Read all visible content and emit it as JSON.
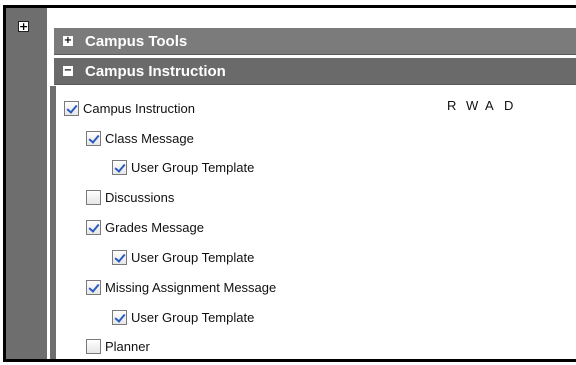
{
  "sections": {
    "tools": {
      "label": "Campus Tools",
      "toggle": "+"
    },
    "instruction": {
      "label": "Campus Instruction",
      "toggle": "−"
    }
  },
  "outer_toggle": "+",
  "rights_headers": [
    "R",
    "W",
    "A",
    "D"
  ],
  "tree": [
    {
      "label": "Campus Instruction",
      "checked": true
    },
    {
      "label": "Class Message",
      "checked": true
    },
    {
      "label": "User Group Template",
      "checked": true
    },
    {
      "label": "Discussions",
      "checked": false
    },
    {
      "label": "Grades Message",
      "checked": true
    },
    {
      "label": "User Group Template",
      "checked": true
    },
    {
      "label": "Missing Assignment Message",
      "checked": true
    },
    {
      "label": "User Group Template",
      "checked": true
    },
    {
      "label": "Planner",
      "checked": false
    }
  ]
}
